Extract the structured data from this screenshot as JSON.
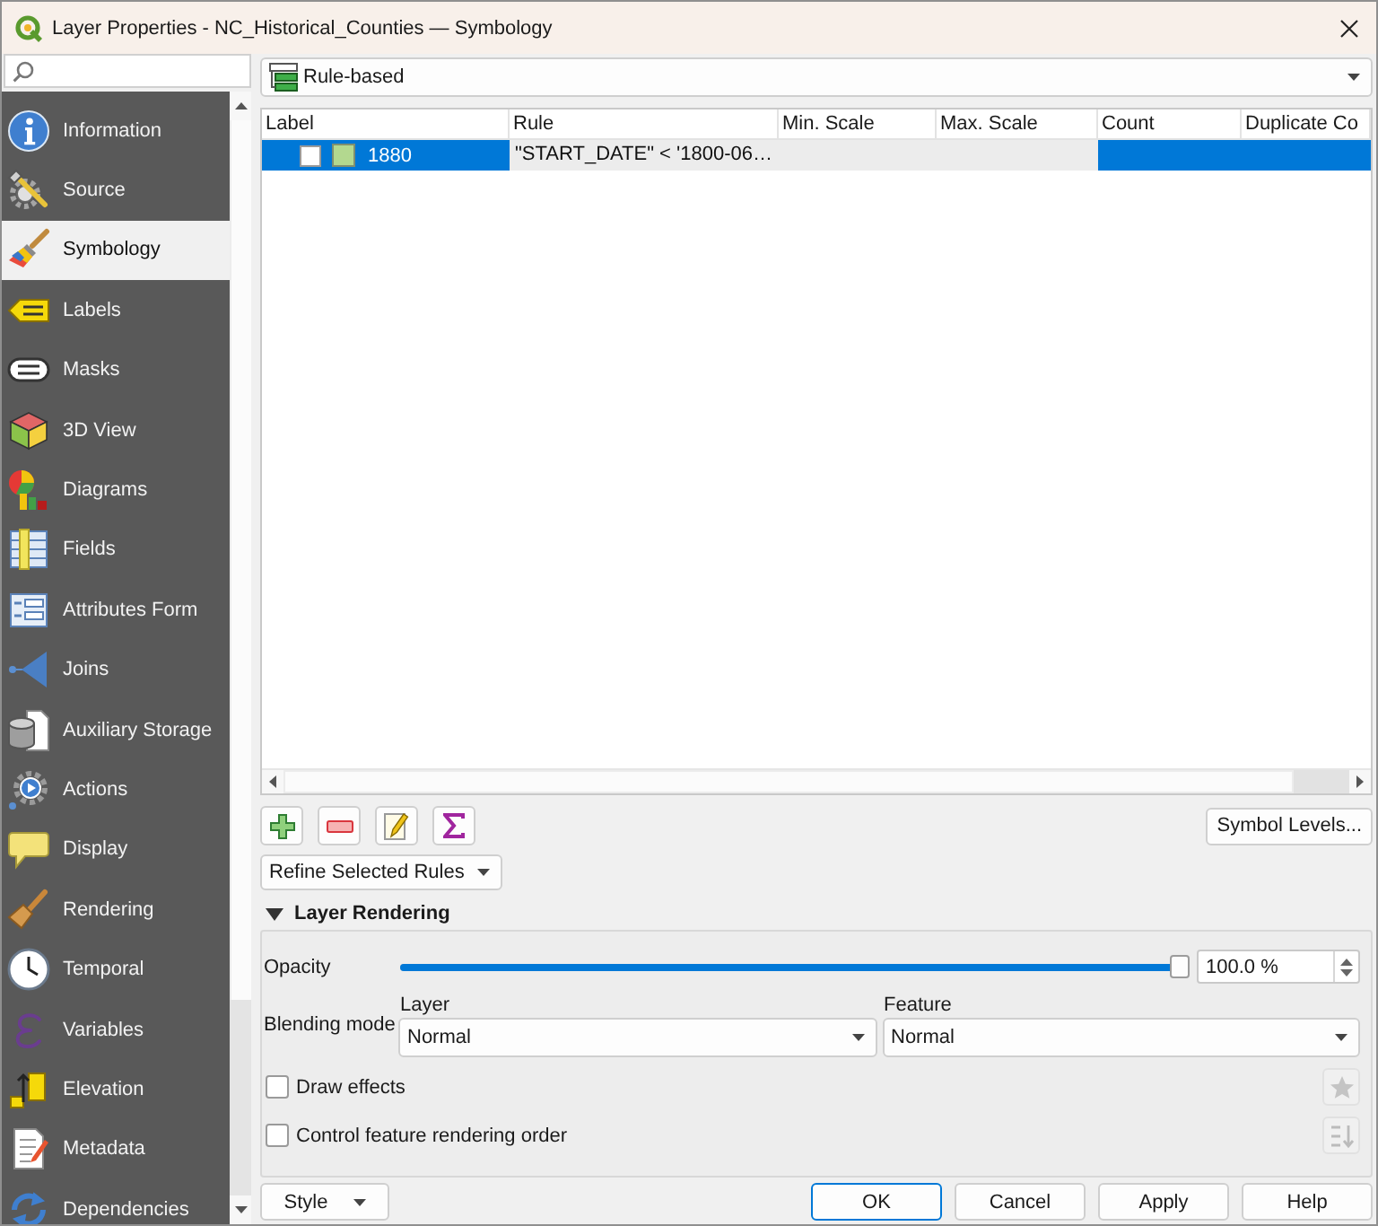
{
  "window": {
    "title": "Layer Properties - NC_Historical_Counties — Symbology"
  },
  "sidebar": {
    "items": [
      {
        "label": "Information",
        "selected": false
      },
      {
        "label": "Source",
        "selected": false
      },
      {
        "label": "Symbology",
        "selected": true
      },
      {
        "label": "Labels",
        "selected": false
      },
      {
        "label": "Masks",
        "selected": false
      },
      {
        "label": "3D View",
        "selected": false
      },
      {
        "label": "Diagrams",
        "selected": false
      },
      {
        "label": "Fields",
        "selected": false
      },
      {
        "label": "Attributes Form",
        "selected": false
      },
      {
        "label": "Joins",
        "selected": false
      },
      {
        "label": "Auxiliary Storage",
        "selected": false
      },
      {
        "label": "Actions",
        "selected": false
      },
      {
        "label": "Display",
        "selected": false
      },
      {
        "label": "Rendering",
        "selected": false
      },
      {
        "label": "Temporal",
        "selected": false
      },
      {
        "label": "Variables",
        "selected": false
      },
      {
        "label": "Elevation",
        "selected": false
      },
      {
        "label": "Metadata",
        "selected": false
      },
      {
        "label": "Dependencies",
        "selected": false
      }
    ]
  },
  "renderer": {
    "value": "Rule-based"
  },
  "rules_table": {
    "columns": [
      "Label",
      "Rule",
      "Min. Scale",
      "Max. Scale",
      "Count",
      "Duplicate Co"
    ],
    "rows": [
      {
        "selected": true,
        "checked": false,
        "color": "#b3d88f",
        "label": "1880",
        "rule": "\"START_DATE\" < '1800-06…"
      }
    ]
  },
  "symbol_levels_button": {
    "label": "Symbol Levels..."
  },
  "refine_menu": {
    "label": "Refine Selected Rules"
  },
  "layer_rendering": {
    "title": "Layer Rendering",
    "expanded": true,
    "opacity": {
      "label": "Opacity",
      "level": 1,
      "reading": "100.0 %"
    },
    "blending": {
      "label": "Blending mode",
      "layer": {
        "label": "Layer",
        "value": "Normal"
      },
      "feature": {
        "label": "Feature",
        "value": "Normal"
      }
    },
    "options": [
      {
        "label": "Draw effects",
        "checked": false,
        "tool_disabled": true
      },
      {
        "label": "Control feature rendering order",
        "checked": false,
        "tool_disabled": true
      }
    ]
  },
  "style_menu": {
    "label": "Style"
  },
  "dialog_buttons": [
    {
      "label": "OK",
      "default": true
    },
    {
      "label": "Cancel",
      "default": false
    },
    {
      "label": "Apply",
      "default": false
    },
    {
      "label": "Help",
      "default": false
    }
  ]
}
